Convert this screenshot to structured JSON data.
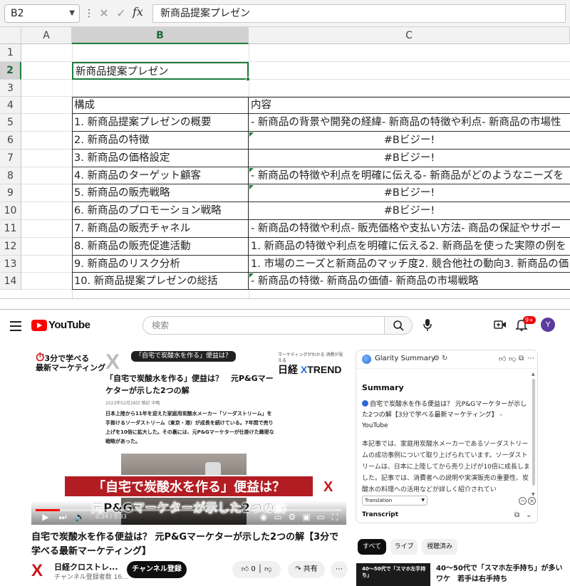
{
  "excel": {
    "name_box": "B2",
    "formula_text": "新商品提案プレゼン",
    "fx": "fx",
    "columns": [
      "A",
      "B",
      "C"
    ],
    "rows": [
      "1",
      "2",
      "3",
      "4",
      "5",
      "6",
      "7",
      "8",
      "9",
      "10",
      "11",
      "12",
      "13",
      "14"
    ],
    "b2": "新商品提案プレゼン",
    "table": [
      [
        "構成",
        "内容"
      ],
      [
        "1. 新商品提案プレゼンの概要",
        "- 新商品の背景や開発の経緯- 新商品の特徴や利点- 新商品の市場性"
      ],
      [
        "2. 新商品の特徴",
        "#Bビジー!"
      ],
      [
        "3. 新商品の価格設定",
        "#Bビジー!"
      ],
      [
        "4. 新商品のターゲット顧客",
        "- 新商品の特徴や利点を明確に伝える- 新商品がどのようなニーズを"
      ],
      [
        "5. 新商品の販売戦略",
        "#Bビジー!"
      ],
      [
        "6. 新商品のプロモーション戦略",
        "#Bビジー!"
      ],
      [
        "7. 新商品の販売チャネル",
        "- 新商品の特徴や利点- 販売価格や支払い方法- 商品の保証やサポー"
      ],
      [
        "8. 新商品の販売促進活動",
        "1. 新商品の特徴や利点を明確に伝える2. 新商品を使った実際の例を"
      ],
      [
        "9. 新商品のリスク分析",
        "1. 市場のニーズと新商品のマッチ度2. 競合他社の動向3. 新商品の価"
      ],
      [
        "10. 新商品提案プレゼンの総括",
        "- 新商品の特徴- 新商品の価値- 新商品の市場戦略"
      ]
    ]
  },
  "youtube": {
    "logo_text": "YouTube",
    "search_placeholder": "検索",
    "notif_count": "9+",
    "avatar_letter": "Y",
    "video": {
      "brand_line1": "3分で学べる",
      "brand_line2": "最新マーケティング",
      "bubble": "「自宅で炭酸水を作る」便益は？",
      "trend_small": "マーケティングがわかる 消費が見える",
      "trend_prefix": "日経",
      "trend_x": "X",
      "trend_word": "TREND",
      "article_title": "「自宅で炭酸水を作る」便益は？　元P&Gマーケターが示した2つの解",
      "article_meta": "2023年02月28日 雑記 中略",
      "article_body": "日本上陸から11年を迎えた家庭用炭酸水メーカー「ソーダストリーム」を手掛けるソーダストリーム（東京・港）が成長を続けている。7年間で売り上げを10倍に拡大した。その裏には、元P&Gマーケターが仕掛けた緻密な戦略があった。",
      "banner": "「自宅で炭酸水を作る」便益は？",
      "subtitle": "元P&Gマーケターが示した2つの解",
      "time": "0:24 / 5:33"
    },
    "title": "自宅で炭酸水を作る便益は？ 元P&Gマーケターが示した2つの解【3分で学べる最新マーケティング】",
    "channel_name": "日経クロストレ...",
    "channel_subs": "チャンネル登録者数 16...",
    "subscribe": "チャンネル登録",
    "likes": "0",
    "share": "共有",
    "glarity": {
      "title": "Glarity Summary",
      "summary_heading": "Summary",
      "link_text": "自宅で炭酸水を作る便益は？ 元P&Gマーケターが示した2つの解【3分で学べる最新マーケティング】 - YouTube",
      "paragraph": "本記事では、家庭用炭酸水メーカーであるソーダストリームの成功事例について取り上げられています。ソーダストリームは、日本に上陸してから売り上げが10倍に成長しました。記事では、消費者への説明や実演販売の重要性、炭酸水の料理への活用などが詳しく紹介されてい",
      "select": "Translation",
      "transcript": "Transcript"
    },
    "chips": [
      "すべて",
      "ライブ",
      "視聴済み"
    ],
    "rec_thumb_text": "40〜50代で「スマホ左手持ち」",
    "rec_title": "40〜50代で「スマホ左手持ち」が多いワケ　若手は右手持ち"
  }
}
